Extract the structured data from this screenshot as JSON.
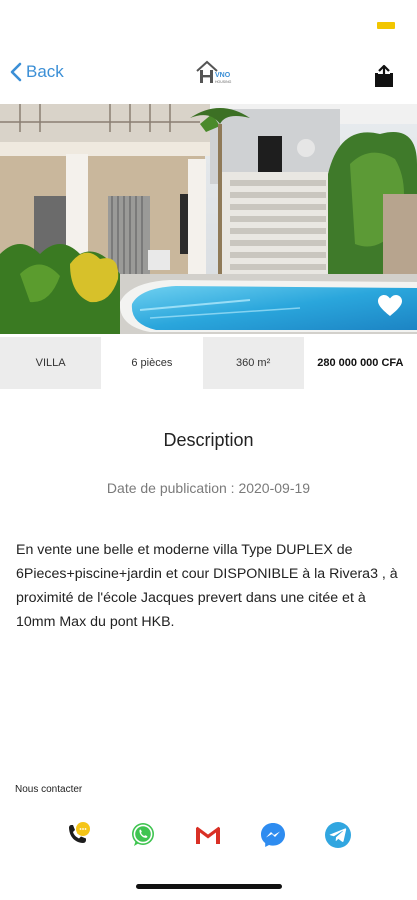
{
  "status_bar": {
    "battery_color": "#f2c600"
  },
  "navbar": {
    "back_label": "Back",
    "back_icon": "chevron-left-icon",
    "share_icon": "share-icon",
    "accent_color": "#3b8fd6",
    "logo_text": "VNO",
    "logo_subtext": "HOUSING"
  },
  "hero": {
    "favorite_icon": "heart-icon"
  },
  "property": {
    "type": "VILLA",
    "rooms": "6 pièces",
    "area": "360 m²",
    "price": "280 000 000 CFA"
  },
  "description": {
    "title": "Description",
    "publication_date": "Date de publication : 2020-09-19",
    "text": "En vente une belle et moderne villa Type DUPLEX de 6Pieces+piscine+jardin et cour DISPONIBLE à la Rivera3 , à proximité de l'école Jacques prevert dans une citée et à 10mm Max du pont HKB."
  },
  "contact": {
    "label": "Nous contacter",
    "icons": [
      "phone-icon",
      "whatsapp-icon",
      "gmail-icon",
      "messenger-icon",
      "telegram-icon"
    ]
  }
}
